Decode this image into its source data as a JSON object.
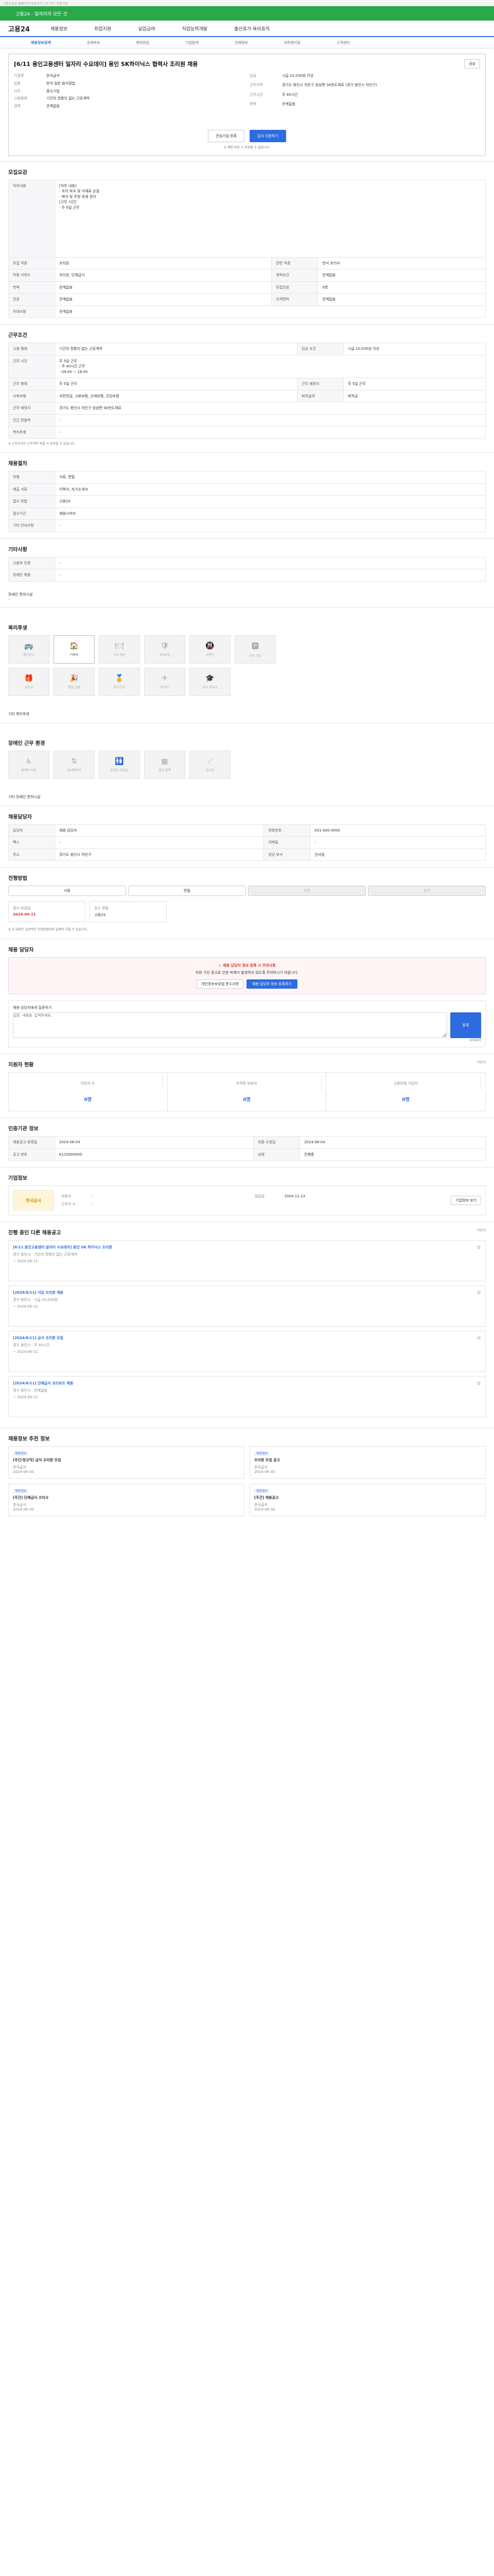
{
  "top": {
    "notice": "고용노동부 홈페이지 바로가기 / 로그인 / 회원가입"
  },
  "banner": {
    "text": "고용24 - 일자리의 모든 것"
  },
  "gnb": {
    "logo": "고용24",
    "items": [
      "채용정보",
      "취업지원",
      "실업급여",
      "직업능력개발",
      "출산휴가·육아휴직"
    ]
  },
  "subnav": {
    "items": [
      "채용정보검색",
      "공채속보",
      "해외취업",
      "기업탐색",
      "인재정보",
      "대학생지원",
      "고객센터"
    ],
    "active": 0
  },
  "job": {
    "title": "[6/11 용인고용센터 일자리 수요데이] 용인 SK하이닉스 협력사 조리원 채용",
    "share_label": "공유",
    "company_label": "기업명",
    "company": "한국급식",
    "industry_label": "업종",
    "industry": "한식 일반 음식점업",
    "size_label": "규모",
    "size": "중소기업",
    "wage_label": "임금",
    "wage": "시급 10,030원 이상",
    "loc_label": "근무지역",
    "loc": "경기도 용인시 처인구 원삼면 SK반도체로 (경기 용인시 처인구)",
    "reg_label": "고용형태",
    "reg": "기간의 정함이 없는 근로계약",
    "hours_label": "근무시간",
    "hours": "주 40시간",
    "career_label": "경력",
    "career": "관계없음",
    "edu_label": "학력",
    "edu": "관계없음",
    "apply_btn": "입사 지원하기",
    "scrap_btn": "관심기업 등록",
    "deadline_note": "※ 채용 마감 시 지원할 수 없습니다."
  },
  "req": {
    "h": "모집요강",
    "work_label": "직무내용",
    "work": "[직무 내용]\n- 조리 보조 및 식재료 손질\n- 배식 및 주방 위생 관리\n[근무 시간]\n- 주 5일 근무",
    "rows": [
      {
        "k": "모집 직종",
        "v": "조리원",
        "k2": "관련 직종",
        "v2": "한식 조리사"
      },
      {
        "k": "직종 키워드",
        "v": "조리원, 단체급식",
        "k2": "경력조건",
        "v2": "관계없음"
      },
      {
        "k": "학력",
        "v": "관계없음",
        "k2": "모집인원",
        "v2": "0명"
      },
      {
        "k": "전공",
        "v": "관계없음",
        "k2": "자격면허",
        "v2": "관계없음"
      },
      {
        "k": "우대사항",
        "v": "관계없음",
        "k2": "",
        "v2": ""
      }
    ]
  },
  "cond": {
    "h": "근무조건",
    "rows": [
      {
        "k": "고용 형태",
        "v": "기간의 정함이 없는 근로계약",
        "k2": "임금 조건",
        "v2": "시급 10,030원 이상"
      },
      {
        "k": "근무 시간",
        "v": "주 5일 근무\n- 주 40시간 근무\n- 09:00 ~ 18:00",
        "k2": "",
        "v2": ""
      },
      {
        "k": "근무 형태",
        "v": "주 5일 근무",
        "k2": "근무 예정지",
        "v2": "주 5일 근무"
      },
      {
        "k": "사회보험",
        "v": "국민연금, 고용보험, 산재보험, 건강보험",
        "k2": "퇴직급여",
        "v2": "퇴직금"
      },
      {
        "k": "근무 예정지",
        "v": "경기도 용인시 처인구 원삼면 SK반도체로",
        "k2": "",
        "v2": ""
      },
      {
        "k": "인근 전철역",
        "v": "-",
        "k2": "",
        "v2": ""
      },
      {
        "k": "복리후생",
        "v": "-",
        "k2": "",
        "v2": ""
      }
    ],
    "note": "※ 근로조건은 근로계약 체결 시 달라질 수 있습니다."
  },
  "recruit": {
    "h": "채용절차",
    "rows": [
      {
        "k": "전형",
        "v": "서류, 면접"
      },
      {
        "k": "제출 서류",
        "v": "이력서, 자기소개서"
      },
      {
        "k": "접수 방법",
        "v": "고용24"
      },
      {
        "k": "접수기간",
        "v": "채용시까지"
      },
      {
        "k": "기타 안내사항",
        "v": "-"
      }
    ]
  },
  "etc": {
    "h": "기타사항",
    "rows": [
      {
        "k": "고용부 인증",
        "v": "-"
      },
      {
        "k": "장애인 채용",
        "v": "-"
      }
    ]
  },
  "disab": {
    "h": "장애인 편의시설",
    "empty": "-"
  },
  "welfare": {
    "h": "복리후생",
    "items": [
      "통근버스",
      "기숙사",
      "식사 제공",
      "4대보험",
      "교통비",
      "주차 가능",
      "경조금",
      "명절 선물",
      "장기근속",
      "휴가비",
      "자녀 학자금"
    ],
    "on": [
      1
    ]
  },
  "welfare_note": "기타 복리후생",
  "env": {
    "h": "장애인 근무 환경",
    "items": [
      "휠체어 이동",
      "엘리베이터",
      "장애인 화장실",
      "점자 블록",
      "경사로"
    ]
  },
  "env_note": "기타 장애인 편의시설",
  "manager": {
    "h": "채용담당자",
    "rows": [
      {
        "k": "담당자",
        "v": "채용 담당자",
        "k2": "전화번호",
        "v2": "031-000-0000"
      },
      {
        "k": "팩스",
        "v": "-",
        "k2": "이메일",
        "v2": "-"
      },
      {
        "k": "주소",
        "v": "경기도 용인시 처인구",
        "k2": "담당 부서",
        "v2": "인사팀"
      }
    ]
  },
  "process": {
    "h": "전형방법",
    "steps": [
      "서류",
      "면접",
      "최종",
      "합격"
    ],
    "apply_date_label": "접수 마감일",
    "apply_date": "2024-06-11",
    "apply_method_label": "접수 방법",
    "apply_method": "고용24",
    "note": "※ 위 내용은 일반적인 전형방법이며 실제와 다를 수 있습니다."
  },
  "warn": {
    "h": "채용 담당자",
    "title": "⚠ 채용 담당자 정보 등록 시 주의사항",
    "text": "허위 구인 광고로 인한 피해가 발생하지 않도록 주의하시기 바랍니다.",
    "btn1": "개인정보보호법 준수사항",
    "btn2": "채용 담당자 정보 등록하기"
  },
  "qna": {
    "h": "채용 담당자에게 질문하기",
    "placeholder": "질문 내용을 입력하세요.",
    "count": "0/300자",
    "submit": "등록"
  },
  "applicants": {
    "h": "지원자 현황",
    "more": "더보기",
    "labels": [
      "지원자 수",
      "자격증 보유자",
      "고용보험 가입자"
    ],
    "values": [
      "0명",
      "0명",
      "0명"
    ]
  },
  "history": {
    "h": "인증기관 정보",
    "rows": [
      {
        "k": "채용공고 등록일",
        "v": "2024-06-04",
        "k2": "최종 수정일",
        "v2": "2024-06-04"
      },
      {
        "k": "공고 번호",
        "v": "K120000000",
        "k2": "상태",
        "v2": "진행중"
      }
    ]
  },
  "company": {
    "h": "기업정보",
    "name": "한국급식",
    "ceo": "대표자",
    "ceo_v": "-",
    "est": "설립일",
    "est_v": "2004.12.13",
    "emp": "근로자 수",
    "emp_v": "-",
    "btn": "기업정보 보기"
  },
  "others": {
    "h": "진행 중인 다른 채용공고",
    "more": "더보기",
    "items": [
      {
        "title": "[6/11 용인고용센터 일자리 수요데이] 용인 SK 하이닉스 조리원",
        "meta": "경기 용인시 · 기간의 정함이 없는 근로계약",
        "date": "~ 2024-06-11"
      },
      {
        "title": "[2024/6/11] 식당 조리원 채용",
        "meta": "경기 용인시 · 시급 10,030원",
        "date": "~ 2024-06-11"
      },
      {
        "title": "[2024/6/11] 급식 조리원 모집",
        "meta": "경기 용인시 · 주 40시간",
        "date": "~ 2024-06-11"
      },
      {
        "title": "[2024/6/11] 단체급식 조리보조 채용",
        "meta": "경기 용인시 · 관계없음",
        "date": "~ 2024-06-11"
      }
    ]
  },
  "recommend": {
    "h": "채용정보 추천 정보",
    "items": [
      {
        "badge": "채용정보",
        "title": "[주간/정규직] 급식 조리원 모집",
        "co": "한국급식",
        "date": "2024-06-30"
      },
      {
        "badge": "채용정보",
        "title": "조리원 모집 공고",
        "co": "한국급식",
        "date": "2024-06-30"
      },
      {
        "badge": "채용정보",
        "title": "[주간] 단체급식 조리사",
        "co": "한국급식",
        "date": "2024-06-30"
      },
      {
        "badge": "채용정보",
        "title": "[주간] 채용공고",
        "co": "한국급식",
        "date": "2024-06-30"
      }
    ]
  }
}
